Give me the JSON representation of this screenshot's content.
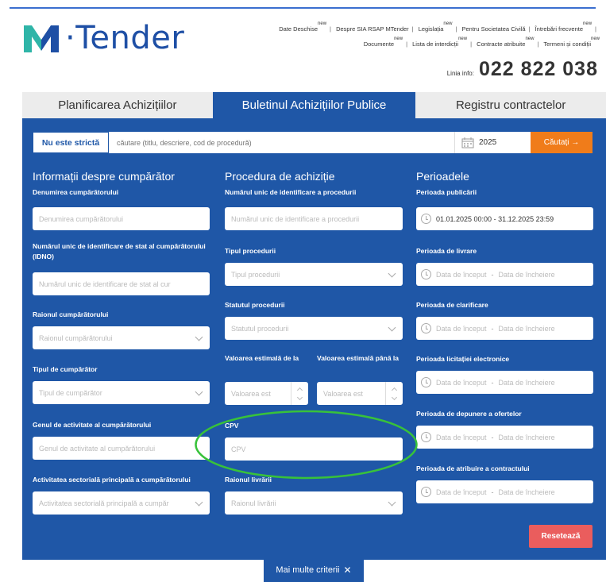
{
  "logo": {
    "text": "·Tender",
    "mark_letter": "M",
    "mark_colors": [
      "#2fb5a8",
      "#1e4fa5"
    ]
  },
  "header_links": {
    "row1": [
      {
        "label": "Date Deschise",
        "sup": "new"
      },
      {
        "label": "Despre SIA RSAP MTender",
        "sup": ""
      },
      {
        "label": "Legislația",
        "sup": "new"
      },
      {
        "label": "Pentru Societatea Civilă",
        "sup": ""
      },
      {
        "label": "Întrebări frecvente",
        "sup": "new"
      }
    ],
    "row2": [
      {
        "label": "Documente",
        "sup": "new"
      },
      {
        "label": "Lista de interdicții",
        "sup": "new"
      },
      {
        "label": "Contracte atribuite",
        "sup": "new"
      },
      {
        "label": "Termeni și condiții",
        "sup": "new"
      }
    ]
  },
  "phone": {
    "label": "Linia info:",
    "number": "022 822 038"
  },
  "tabs": [
    "Planificarea Achizițiilor",
    "Buletinul Achizițiilor Publice",
    "Registru contractelor"
  ],
  "search": {
    "strict_label": "Nu este strictă",
    "placeholder": "căutare (titlu, descriere, cod de procedură)",
    "year": "2025",
    "button": "Căutați →"
  },
  "col1": {
    "title": "Informații despre cumpărător",
    "buyer_name_label": "Denumirea cumpărătorului",
    "buyer_name_placeholder": "Denumirea cumpărătorului",
    "idno_label": "Numărul unic de identificare de stat al cumpărătorului (IDNO)",
    "idno_placeholder": "Numărul unic de identificare de stat al cur",
    "raion_label": "Raionul cumpărătorului",
    "raion_placeholder": "Raionul cumpărătorului",
    "buyer_type_label": "Tipul de cumpărător",
    "buyer_type_placeholder": "Tipul de cumpărător",
    "activity_label": "Genul de activitate al cumpărătorului",
    "activity_placeholder": "Genul de activitate al cumpărătorului",
    "sector_label": "Activitatea sectorială principală a cumpărătorului",
    "sector_placeholder": "Activitatea sectorială principală a cumpăr"
  },
  "col2": {
    "title": "Procedura de achiziție",
    "proc_id_label": "Numărul unic de identificare a procedurii",
    "proc_id_placeholder": "Numărul unic de identificare a procedurii",
    "proc_type_label": "Tipul procedurii",
    "proc_type_placeholder": "Tipul procedurii",
    "proc_status_label": "Statutul procedurii",
    "proc_status_placeholder": "Statutul procedurii",
    "value_from_label": "Valoarea estimală de la",
    "value_from_placeholder": "Valoarea est",
    "value_to_label": "Valoarea estimală până la",
    "value_to_placeholder": "Valoarea est",
    "cpv_label": "CPV",
    "cpv_placeholder": "CPV",
    "delivery_label": "Raionul livrării",
    "delivery_placeholder": "Raionul livrării"
  },
  "col3": {
    "title": "Perioadele",
    "publication_label": "Perioada publicării",
    "publication_value": "01.01.2025 00:00 - 31.12.2025 23:59",
    "delivery_label": "Perioada de livrare",
    "clarification_label": "Perioada de clarificare",
    "auction_label": "Perioada licitației electronice",
    "submission_label": "Perioada de depunere a ofertelor",
    "award_label": "Perioada de atribuire a contractului",
    "start_placeholder": "Data de început",
    "end_placeholder": "Data de încheiere",
    "dash": "-"
  },
  "reset_button": "Resetează",
  "more_button": "Mai multe criterii",
  "more_close": "✕",
  "colors": {
    "panel": "#1f57a7",
    "accent_orange": "#f07c1a",
    "reset_red": "#ea5d5d",
    "highlight_green": "#38c23a"
  }
}
